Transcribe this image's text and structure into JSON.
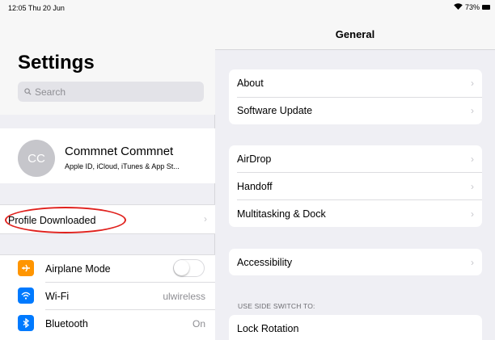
{
  "status_bar": {
    "time_date": "12:05  Thu 20 Jun",
    "battery": "73%",
    "wifi_icon": "wifi-icon",
    "battery_icon": "battery-icon"
  },
  "sidebar": {
    "title": "Settings",
    "search_placeholder": "Search",
    "account": {
      "initials": "CC",
      "name": "Commnet Commnet",
      "subtitle": "Apple ID, iCloud, iTunes & App St..."
    },
    "profile_row": {
      "label": "Profile Downloaded",
      "annotation_color": "#e0211d"
    },
    "items": [
      {
        "label": "Airplane Mode",
        "icon": "airplane-icon",
        "icon_color": "#ff9500",
        "toggle_on": false
      },
      {
        "label": "Wi-Fi",
        "icon": "wifi-icon",
        "icon_color": "#007aff",
        "value": "ulwireless"
      },
      {
        "label": "Bluetooth",
        "icon": "bluetooth-icon",
        "icon_color": "#007aff",
        "value": "On"
      }
    ]
  },
  "general": {
    "title": "General",
    "groups": [
      {
        "items": [
          "About",
          "Software Update"
        ]
      },
      {
        "items": [
          "AirDrop",
          "Handoff",
          "Multitasking & Dock"
        ]
      },
      {
        "items": [
          "Accessibility"
        ]
      }
    ],
    "side_switch_header": "USE SIDE SWITCH TO:",
    "side_switch_option": "Lock Rotation"
  }
}
